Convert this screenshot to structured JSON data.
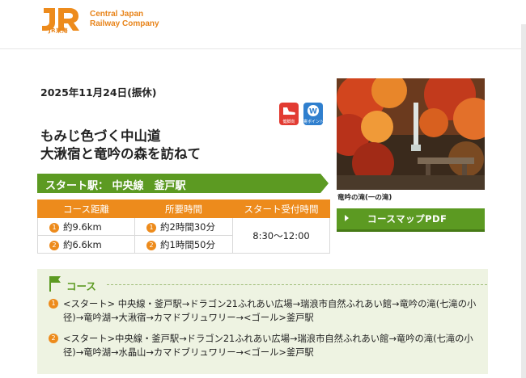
{
  "header": {
    "logo_sub": "JR東海",
    "company_line1": "Central Japan",
    "company_line2": "Railway Company"
  },
  "event": {
    "date": "2025年11月24日(振休)",
    "title_line1": "もみじ色づく中山道",
    "title_line2": "大湫宿と竜吟の森を訪ねて",
    "start_station": "スタート駅： 中央線　釜戸駅",
    "icon_labels": [
      "健脚向",
      "寄ポイント"
    ]
  },
  "info_table": {
    "headers": [
      "コース距離",
      "所要時間",
      "スタート受付時間"
    ],
    "rows": [
      {
        "num": "1",
        "distance": "約9.6km",
        "time": "約2時間30分"
      },
      {
        "num": "2",
        "distance": "約6.6km",
        "time": "約1時間50分"
      }
    ],
    "start_time": "8:30〜12:00"
  },
  "photo": {
    "caption": "竜吟の滝(一の滝)"
  },
  "pdf_button": {
    "label": "コースマップPDF"
  },
  "course": {
    "heading": "コース",
    "routes": [
      {
        "num": "1",
        "text": "<スタート> 中央線・釜戸駅→ドラゴン21ふれあい広場→瑞浪市自然ふれあい館→竜吟の滝(七滝の小径)→竜吟湖→大湫宿→カマドブリュワリー→<ゴール>釜戸駅"
      },
      {
        "num": "2",
        "text": "<スタート>中央線・釜戸駅→ドラゴン21ふれあい広場→瑞浪市自然ふれあい館→竜吟の滝(七滝の小径)→竜吟湖→水晶山→カマドブリュワリー→<ゴール>釜戸駅"
      }
    ]
  },
  "colors": {
    "brand_orange": "#ed8b1c",
    "accent_green": "#5c9a22",
    "panel_green": "#eef3e2"
  }
}
